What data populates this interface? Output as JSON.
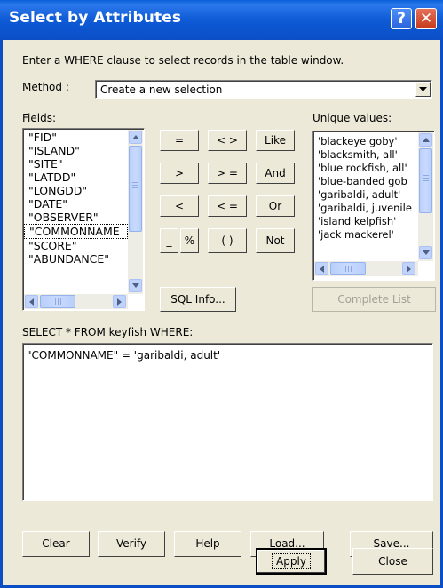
{
  "window": {
    "title": "Select by Attributes",
    "help_button": "?",
    "close_button": "✕"
  },
  "instruction": "Enter a WHERE clause to select records in the table window.",
  "method": {
    "label": "Method :",
    "value": "Create a new selection"
  },
  "fields": {
    "label": "Fields:",
    "items": [
      "\"FID\"",
      "\"ISLAND\"",
      "\"SITE\"",
      "\"LATDD\"",
      "\"LONGDD\"",
      "\"DATE\"",
      "\"OBSERVER\"",
      "\"COMMONNAME",
      "\"SCORE\"",
      "\"ABUNDANCE\""
    ]
  },
  "operators": {
    "equals": "=",
    "not_equal": "< >",
    "like": "Like",
    "greater": ">",
    "greater_equal": "> =",
    "and": "And",
    "less": "<",
    "less_equal": "< =",
    "or": "Or",
    "underscore": "_",
    "percent": "%",
    "parens": "( )",
    "not": "Not"
  },
  "sql_info_button": "SQL Info...",
  "unique_values": {
    "label": "Unique values:",
    "items": [
      "'blackeye goby'",
      "'blacksmith, all'",
      "'blue rockfish, all'",
      "'blue-banded gob",
      "'garibaldi, adult'",
      "'garibaldi, juvenile",
      "'island kelpfish'",
      "'jack mackerel'"
    ],
    "complete_list_button": "Complete List"
  },
  "query": {
    "prefix": "SELECT * FROM keyfish WHERE:",
    "expression": "\"COMMONNAME\" = 'garibaldi, adult'"
  },
  "bottom_buttons": {
    "clear": "Clear",
    "verify": "Verify",
    "help": "Help",
    "load": "Load...",
    "save": "Save..."
  },
  "dialog_buttons": {
    "apply": "Apply",
    "close": "Close"
  },
  "colors": {
    "titlebar": "#0b4fc7",
    "dialog_bg": "#ece9d8",
    "close_button": "#c6391b"
  }
}
